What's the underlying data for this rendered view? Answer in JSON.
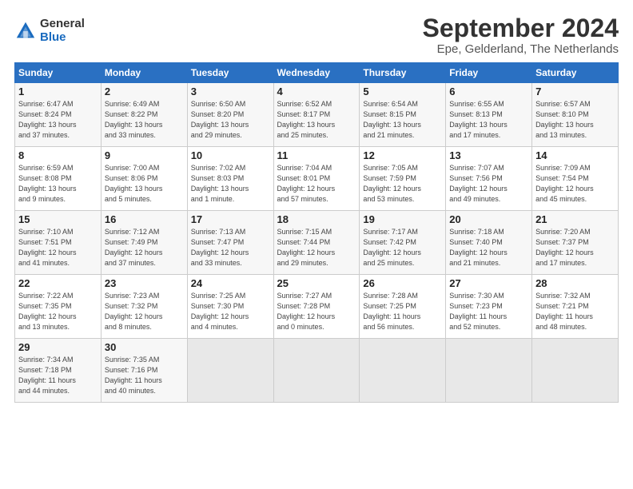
{
  "logo": {
    "general": "General",
    "blue": "Blue"
  },
  "title": "September 2024",
  "subtitle": "Epe, Gelderland, The Netherlands",
  "days_header": [
    "Sunday",
    "Monday",
    "Tuesday",
    "Wednesday",
    "Thursday",
    "Friday",
    "Saturday"
  ],
  "weeks": [
    [
      {
        "day": "1",
        "detail": "Sunrise: 6:47 AM\nSunset: 8:24 PM\nDaylight: 13 hours\nand 37 minutes."
      },
      {
        "day": "2",
        "detail": "Sunrise: 6:49 AM\nSunset: 8:22 PM\nDaylight: 13 hours\nand 33 minutes."
      },
      {
        "day": "3",
        "detail": "Sunrise: 6:50 AM\nSunset: 8:20 PM\nDaylight: 13 hours\nand 29 minutes."
      },
      {
        "day": "4",
        "detail": "Sunrise: 6:52 AM\nSunset: 8:17 PM\nDaylight: 13 hours\nand 25 minutes."
      },
      {
        "day": "5",
        "detail": "Sunrise: 6:54 AM\nSunset: 8:15 PM\nDaylight: 13 hours\nand 21 minutes."
      },
      {
        "day": "6",
        "detail": "Sunrise: 6:55 AM\nSunset: 8:13 PM\nDaylight: 13 hours\nand 17 minutes."
      },
      {
        "day": "7",
        "detail": "Sunrise: 6:57 AM\nSunset: 8:10 PM\nDaylight: 13 hours\nand 13 minutes."
      }
    ],
    [
      {
        "day": "8",
        "detail": "Sunrise: 6:59 AM\nSunset: 8:08 PM\nDaylight: 13 hours\nand 9 minutes."
      },
      {
        "day": "9",
        "detail": "Sunrise: 7:00 AM\nSunset: 8:06 PM\nDaylight: 13 hours\nand 5 minutes."
      },
      {
        "day": "10",
        "detail": "Sunrise: 7:02 AM\nSunset: 8:03 PM\nDaylight: 13 hours\nand 1 minute."
      },
      {
        "day": "11",
        "detail": "Sunrise: 7:04 AM\nSunset: 8:01 PM\nDaylight: 12 hours\nand 57 minutes."
      },
      {
        "day": "12",
        "detail": "Sunrise: 7:05 AM\nSunset: 7:59 PM\nDaylight: 12 hours\nand 53 minutes."
      },
      {
        "day": "13",
        "detail": "Sunrise: 7:07 AM\nSunset: 7:56 PM\nDaylight: 12 hours\nand 49 minutes."
      },
      {
        "day": "14",
        "detail": "Sunrise: 7:09 AM\nSunset: 7:54 PM\nDaylight: 12 hours\nand 45 minutes."
      }
    ],
    [
      {
        "day": "15",
        "detail": "Sunrise: 7:10 AM\nSunset: 7:51 PM\nDaylight: 12 hours\nand 41 minutes."
      },
      {
        "day": "16",
        "detail": "Sunrise: 7:12 AM\nSunset: 7:49 PM\nDaylight: 12 hours\nand 37 minutes."
      },
      {
        "day": "17",
        "detail": "Sunrise: 7:13 AM\nSunset: 7:47 PM\nDaylight: 12 hours\nand 33 minutes."
      },
      {
        "day": "18",
        "detail": "Sunrise: 7:15 AM\nSunset: 7:44 PM\nDaylight: 12 hours\nand 29 minutes."
      },
      {
        "day": "19",
        "detail": "Sunrise: 7:17 AM\nSunset: 7:42 PM\nDaylight: 12 hours\nand 25 minutes."
      },
      {
        "day": "20",
        "detail": "Sunrise: 7:18 AM\nSunset: 7:40 PM\nDaylight: 12 hours\nand 21 minutes."
      },
      {
        "day": "21",
        "detail": "Sunrise: 7:20 AM\nSunset: 7:37 PM\nDaylight: 12 hours\nand 17 minutes."
      }
    ],
    [
      {
        "day": "22",
        "detail": "Sunrise: 7:22 AM\nSunset: 7:35 PM\nDaylight: 12 hours\nand 13 minutes."
      },
      {
        "day": "23",
        "detail": "Sunrise: 7:23 AM\nSunset: 7:32 PM\nDaylight: 12 hours\nand 8 minutes."
      },
      {
        "day": "24",
        "detail": "Sunrise: 7:25 AM\nSunset: 7:30 PM\nDaylight: 12 hours\nand 4 minutes."
      },
      {
        "day": "25",
        "detail": "Sunrise: 7:27 AM\nSunset: 7:28 PM\nDaylight: 12 hours\nand 0 minutes."
      },
      {
        "day": "26",
        "detail": "Sunrise: 7:28 AM\nSunset: 7:25 PM\nDaylight: 11 hours\nand 56 minutes."
      },
      {
        "day": "27",
        "detail": "Sunrise: 7:30 AM\nSunset: 7:23 PM\nDaylight: 11 hours\nand 52 minutes."
      },
      {
        "day": "28",
        "detail": "Sunrise: 7:32 AM\nSunset: 7:21 PM\nDaylight: 11 hours\nand 48 minutes."
      }
    ],
    [
      {
        "day": "29",
        "detail": "Sunrise: 7:34 AM\nSunset: 7:18 PM\nDaylight: 11 hours\nand 44 minutes."
      },
      {
        "day": "30",
        "detail": "Sunrise: 7:35 AM\nSunset: 7:16 PM\nDaylight: 11 hours\nand 40 minutes."
      },
      {
        "day": "",
        "detail": ""
      },
      {
        "day": "",
        "detail": ""
      },
      {
        "day": "",
        "detail": ""
      },
      {
        "day": "",
        "detail": ""
      },
      {
        "day": "",
        "detail": ""
      }
    ]
  ]
}
